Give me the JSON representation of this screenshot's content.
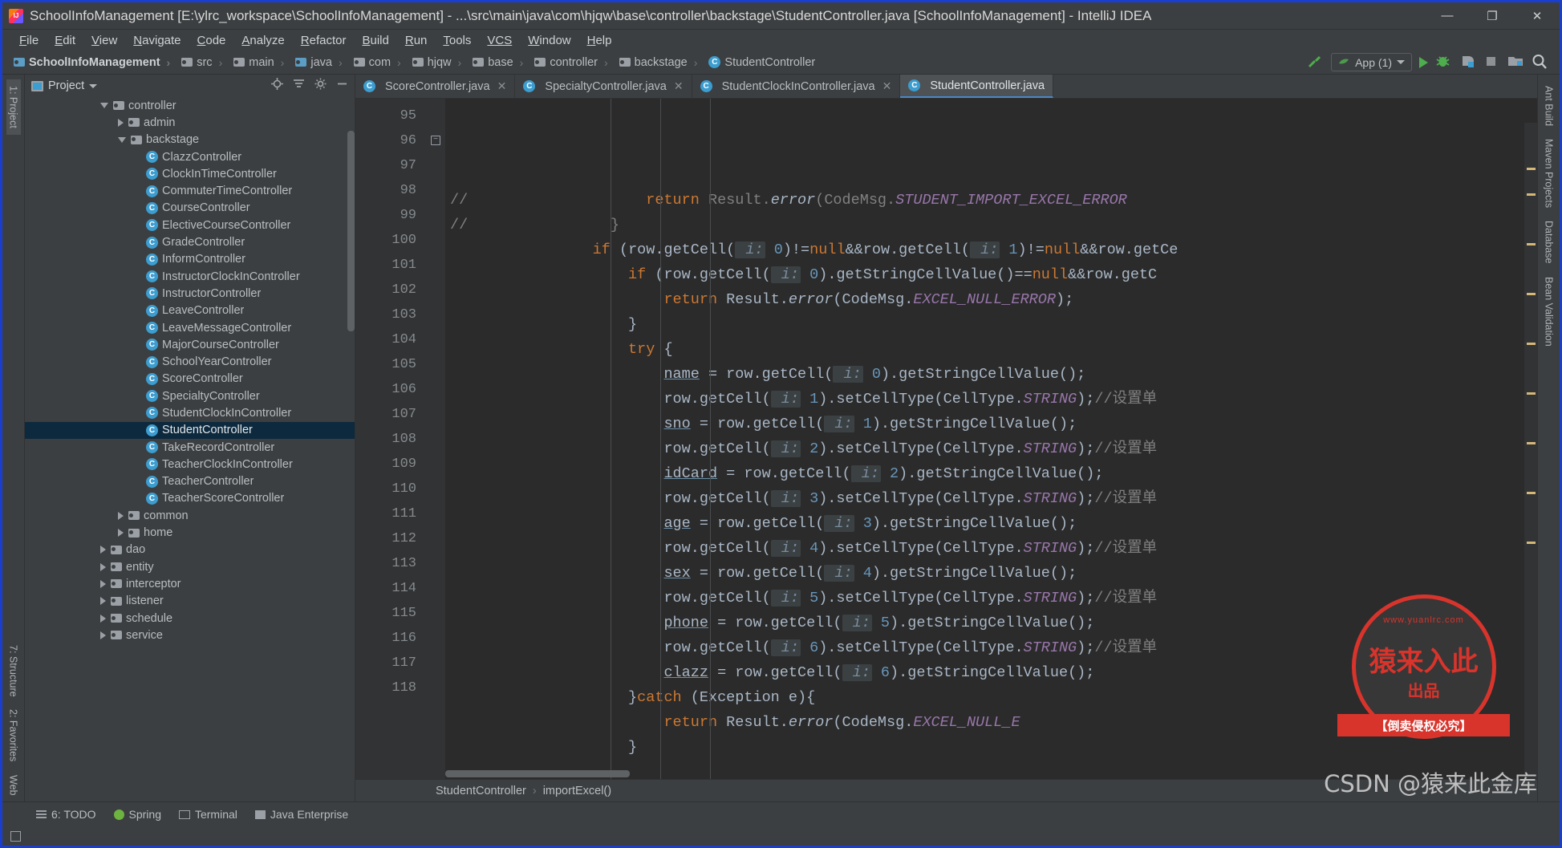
{
  "window": {
    "title": "SchoolInfoManagement [E:\\ylrc_workspace\\SchoolInfoManagement] - ...\\src\\main\\java\\com\\hjqw\\base\\controller\\backstage\\StudentController.java [SchoolInfoManagement] - IntelliJ IDEA",
    "minimize": "—",
    "maximize": "❐",
    "close": "✕",
    "logo": "intellij-idea-logo"
  },
  "menubar": [
    {
      "mnemonic": "F",
      "rest": "ile"
    },
    {
      "mnemonic": "E",
      "rest": "dit"
    },
    {
      "mnemonic": "V",
      "rest": "iew"
    },
    {
      "mnemonic": "N",
      "rest": "avigate"
    },
    {
      "mnemonic": "C",
      "rest": "ode"
    },
    {
      "mnemonic": "A",
      "rest": "nalyze"
    },
    {
      "mnemonic": "R",
      "rest": "efactor"
    },
    {
      "mnemonic": "B",
      "rest": "uild"
    },
    {
      "mnemonic": "R",
      "rest": "un"
    },
    {
      "mnemonic": "T",
      "rest": "ools"
    },
    {
      "mnemonic": "VCS",
      "rest": ""
    },
    {
      "mnemonic": "W",
      "rest": "indow"
    },
    {
      "mnemonic": "H",
      "rest": "elp"
    }
  ],
  "breadcrumbs": [
    {
      "label": "SchoolInfoManagement",
      "icon": "folder-icon-blue",
      "bold": true
    },
    {
      "label": "src",
      "icon": "folder-icon"
    },
    {
      "label": "main",
      "icon": "folder-icon"
    },
    {
      "label": "java",
      "icon": "folder-icon-blue"
    },
    {
      "label": "com",
      "icon": "folder-icon"
    },
    {
      "label": "hjqw",
      "icon": "folder-icon"
    },
    {
      "label": "base",
      "icon": "folder-icon"
    },
    {
      "label": "controller",
      "icon": "folder-icon"
    },
    {
      "label": "backstage",
      "icon": "folder-icon"
    },
    {
      "label": "StudentController",
      "icon": "class-icon",
      "char": "C"
    }
  ],
  "toolbar": {
    "run_config": "App (1)",
    "icons": [
      "build-hammer-icon",
      "run-icon",
      "debug-icon",
      "run-coverage-icon",
      "stop-icon",
      "project-structure-icon",
      "search-everywhere-icon"
    ]
  },
  "project_panel": {
    "title": "Project",
    "header_icons": [
      "locate-icon",
      "collapse-all-icon",
      "settings-gear-icon",
      "hide-icon"
    ],
    "tree": [
      {
        "label": "controller",
        "depth": 4,
        "type": "folder",
        "state": "expanded"
      },
      {
        "label": "admin",
        "depth": 5,
        "type": "folder",
        "state": "collapsed"
      },
      {
        "label": "backstage",
        "depth": 5,
        "type": "folder",
        "state": "expanded"
      },
      {
        "label": "ClazzController",
        "depth": 6,
        "type": "class"
      },
      {
        "label": "ClockInTimeController",
        "depth": 6,
        "type": "class"
      },
      {
        "label": "CommuterTimeController",
        "depth": 6,
        "type": "class"
      },
      {
        "label": "CourseController",
        "depth": 6,
        "type": "class"
      },
      {
        "label": "ElectiveCourseController",
        "depth": 6,
        "type": "class"
      },
      {
        "label": "GradeController",
        "depth": 6,
        "type": "class"
      },
      {
        "label": "InformController",
        "depth": 6,
        "type": "class"
      },
      {
        "label": "InstructorClockInController",
        "depth": 6,
        "type": "class"
      },
      {
        "label": "InstructorController",
        "depth": 6,
        "type": "class"
      },
      {
        "label": "LeaveController",
        "depth": 6,
        "type": "class"
      },
      {
        "label": "LeaveMessageController",
        "depth": 6,
        "type": "class"
      },
      {
        "label": "MajorCourseController",
        "depth": 6,
        "type": "class"
      },
      {
        "label": "SchoolYearController",
        "depth": 6,
        "type": "class"
      },
      {
        "label": "ScoreController",
        "depth": 6,
        "type": "class"
      },
      {
        "label": "SpecialtyController",
        "depth": 6,
        "type": "class"
      },
      {
        "label": "StudentClockInController",
        "depth": 6,
        "type": "class"
      },
      {
        "label": "StudentController",
        "depth": 6,
        "type": "class",
        "selected": true
      },
      {
        "label": "TakeRecordController",
        "depth": 6,
        "type": "class"
      },
      {
        "label": "TeacherClockInController",
        "depth": 6,
        "type": "class"
      },
      {
        "label": "TeacherController",
        "depth": 6,
        "type": "class"
      },
      {
        "label": "TeacherScoreController",
        "depth": 6,
        "type": "class"
      },
      {
        "label": "common",
        "depth": 5,
        "type": "folder",
        "state": "collapsed"
      },
      {
        "label": "home",
        "depth": 5,
        "type": "folder",
        "state": "collapsed"
      },
      {
        "label": "dao",
        "depth": 4,
        "type": "folder",
        "state": "collapsed"
      },
      {
        "label": "entity",
        "depth": 4,
        "type": "folder",
        "state": "collapsed"
      },
      {
        "label": "interceptor",
        "depth": 4,
        "type": "folder",
        "state": "collapsed"
      },
      {
        "label": "listener",
        "depth": 4,
        "type": "folder",
        "state": "collapsed"
      },
      {
        "label": "schedule",
        "depth": 4,
        "type": "folder",
        "state": "collapsed"
      },
      {
        "label": "service",
        "depth": 4,
        "type": "folder",
        "state": "collapsed"
      }
    ]
  },
  "left_rail": [
    {
      "label": "1: Project",
      "active": true
    },
    {
      "label": "7: Structure",
      "active": false
    },
    {
      "label": "2: Favorites",
      "active": false
    },
    {
      "label": "Web",
      "active": false
    }
  ],
  "right_rail": [
    {
      "label": "Ant Build"
    },
    {
      "label": "Maven Projects"
    },
    {
      "label": "Database"
    },
    {
      "label": "Bean Validation"
    }
  ],
  "editor_tabs": [
    {
      "label": "ScoreController.java",
      "active": false,
      "closable": true
    },
    {
      "label": "SpecialtyController.java",
      "active": false,
      "closable": true
    },
    {
      "label": "StudentClockInController.java",
      "active": false,
      "closable": true
    },
    {
      "label": "StudentController.java",
      "active": true,
      "closable": false
    }
  ],
  "editor": {
    "first_line": 95,
    "lines": [
      {
        "n": 95,
        "fold": false
      },
      {
        "n": 96,
        "fold": true
      },
      {
        "n": 97,
        "fold": false
      },
      {
        "n": 98,
        "fold": false
      },
      {
        "n": 99,
        "fold": false
      },
      {
        "n": 100,
        "fold": false
      },
      {
        "n": 101,
        "fold": false
      },
      {
        "n": 102,
        "fold": false
      },
      {
        "n": 103,
        "fold": false
      },
      {
        "n": 104,
        "fold": false
      },
      {
        "n": 105,
        "fold": false
      },
      {
        "n": 106,
        "fold": false
      },
      {
        "n": 107,
        "fold": false
      },
      {
        "n": 108,
        "fold": false
      },
      {
        "n": 109,
        "fold": false
      },
      {
        "n": 110,
        "fold": false
      },
      {
        "n": 111,
        "fold": false
      },
      {
        "n": 112,
        "fold": false
      },
      {
        "n": 113,
        "fold": false
      },
      {
        "n": 114,
        "fold": false
      },
      {
        "n": 115,
        "fold": false
      },
      {
        "n": 116,
        "fold": false
      },
      {
        "n": 117,
        "fold": false
      },
      {
        "n": 118,
        "fold": false
      }
    ],
    "source_text": [
      "//                    return Result.error(CodeMsg.STUDENT_IMPORT_EXCEL_ERROR",
      "//                }",
      "                if (row.getCell( i: 0)!=null&&row.getCell( i: 1)!=null&&row.getCe",
      "                    if (row.getCell( i: 0).getStringCellValue()==null&&row.getC",
      "                        return Result.error(CodeMsg.EXCEL_NULL_ERROR);",
      "                    }",
      "                    try {",
      "                        name = row.getCell( i: 0).getStringCellValue();",
      "                        row.getCell( i: 1).setCellType(CellType.STRING);//设置单",
      "                        sno = row.getCell( i: 1).getStringCellValue();",
      "                        row.getCell( i: 2).setCellType(CellType.STRING);//设置单",
      "                        idCard = row.getCell( i: 2).getStringCellValue();",
      "                        row.getCell( i: 3).setCellType(CellType.STRING);//设置单",
      "                        age = row.getCell( i: 3).getStringCellValue();",
      "                        row.getCell( i: 4).setCellType(CellType.STRING);//设置单",
      "                        sex = row.getCell( i: 4).getStringCellValue();",
      "                        row.getCell( i: 5).setCellType(CellType.STRING);//设置单",
      "                        phone = row.getCell( i: 5).getStringCellValue();",
      "                        row.getCell( i: 6).setCellType(CellType.STRING);//设置单",
      "                        clazz = row.getCell( i: 6).getStringCellValue();",
      "                    }catch (Exception e){",
      "                        return Result.error(CodeMsg.EXCEL_NULL_E",
      "                    }",
      ""
    ]
  },
  "status_breadcrumb": {
    "class": "StudentController",
    "separator": "›",
    "method": "importExcel()"
  },
  "bottom_tools": [
    {
      "label": "6: TODO",
      "icon": "todo-icon"
    },
    {
      "label": "Spring",
      "icon": "spring-icon"
    },
    {
      "label": "Terminal",
      "icon": "terminal-icon"
    },
    {
      "label": "Java Enterprise",
      "icon": "java-enterprise-icon"
    }
  ],
  "watermark": {
    "stamp_site": "www.yuanlrc.com",
    "stamp_big": "猿来入此",
    "stamp_small": "出品",
    "stamp_banner": "【倒卖侵权必究】",
    "csdn_text": "CSDN @猿来此金库"
  },
  "colors": {
    "accent": "#3c9dd0",
    "selection": "#0d293e",
    "panel": "#3c3f41",
    "editor_bg": "#2b2b2b",
    "keyword": "#cc7832",
    "number": "#6897bb",
    "comment": "#808080",
    "static_field": "#9876aa",
    "stamp_red": "#d8342c",
    "window_border": "#1a3fd0"
  }
}
